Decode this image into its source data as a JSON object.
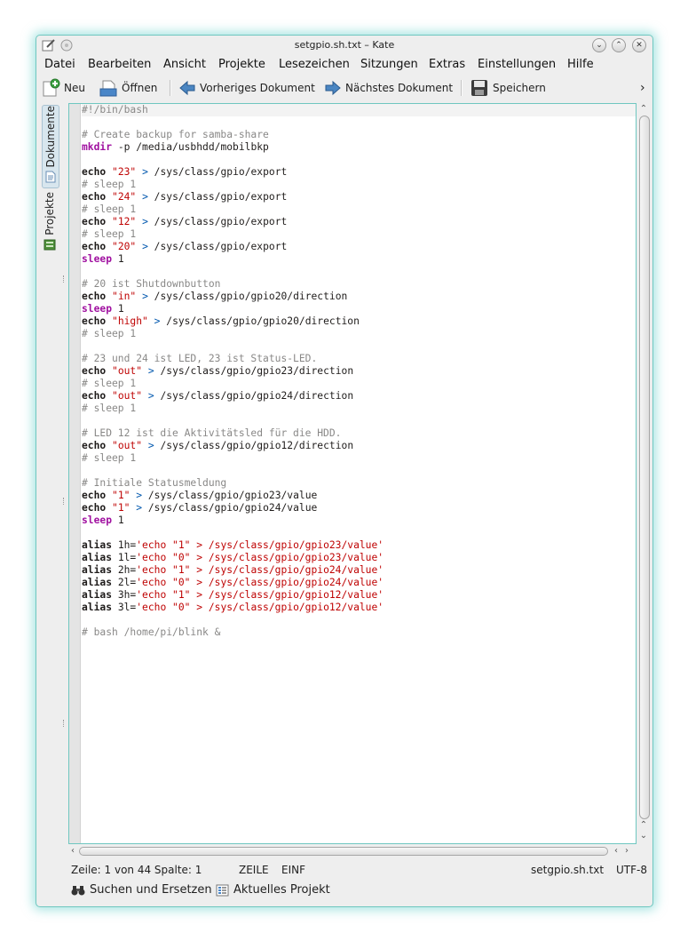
{
  "window": {
    "title": "setgpio.sh.txt – Kate"
  },
  "menu": [
    "Datei",
    "Bearbeiten",
    "Ansicht",
    "Projekte",
    "Lesezeichen",
    "Sitzungen",
    "Extras",
    "Einstellungen",
    "Hilfe"
  ],
  "toolbar": {
    "new_label": "Neu",
    "open_label": "Öffnen",
    "prev_label": "Vorheriges Dokument",
    "next_label": "Nächstes Dokument",
    "save_label": "Speichern",
    "overflow_label": "›"
  },
  "sidebar": {
    "tabs": [
      "Dokumente",
      "Projekte"
    ]
  },
  "editor": {
    "lines": [
      [
        [
          "comment",
          "#!/bin/bash"
        ]
      ],
      [],
      [
        [
          "comment",
          "# Create backup for samba-share"
        ]
      ],
      [
        [
          "cmd",
          "mkdir"
        ],
        [
          "text",
          " -p /media/usbhdd/mobilbkp"
        ]
      ],
      [],
      [
        [
          "kw",
          "echo"
        ],
        [
          "text",
          " "
        ],
        [
          "str",
          "\"23\""
        ],
        [
          "text",
          " "
        ],
        [
          "op",
          ">"
        ],
        [
          "text",
          " /sys/class/gpio/export"
        ]
      ],
      [
        [
          "comment",
          "# sleep 1"
        ]
      ],
      [
        [
          "kw",
          "echo"
        ],
        [
          "text",
          " "
        ],
        [
          "str",
          "\"24\""
        ],
        [
          "text",
          " "
        ],
        [
          "op",
          ">"
        ],
        [
          "text",
          " /sys/class/gpio/export"
        ]
      ],
      [
        [
          "comment",
          "# sleep 1"
        ]
      ],
      [
        [
          "kw",
          "echo"
        ],
        [
          "text",
          " "
        ],
        [
          "str",
          "\"12\""
        ],
        [
          "text",
          " "
        ],
        [
          "op",
          ">"
        ],
        [
          "text",
          " /sys/class/gpio/export"
        ]
      ],
      [
        [
          "comment",
          "# sleep 1"
        ]
      ],
      [
        [
          "kw",
          "echo"
        ],
        [
          "text",
          " "
        ],
        [
          "str",
          "\"20\""
        ],
        [
          "text",
          " "
        ],
        [
          "op",
          ">"
        ],
        [
          "text",
          " /sys/class/gpio/export"
        ]
      ],
      [
        [
          "cmd",
          "sleep"
        ],
        [
          "text",
          " 1"
        ]
      ],
      [],
      [
        [
          "comment",
          "# 20 ist Shutdownbutton"
        ]
      ],
      [
        [
          "kw",
          "echo"
        ],
        [
          "text",
          " "
        ],
        [
          "str",
          "\"in\""
        ],
        [
          "text",
          " "
        ],
        [
          "op",
          ">"
        ],
        [
          "text",
          " /sys/class/gpio/gpio20/direction"
        ]
      ],
      [
        [
          "cmd",
          "sleep"
        ],
        [
          "text",
          " 1"
        ]
      ],
      [
        [
          "kw",
          "echo"
        ],
        [
          "text",
          " "
        ],
        [
          "str",
          "\"high\""
        ],
        [
          "text",
          " "
        ],
        [
          "op",
          ">"
        ],
        [
          "text",
          " /sys/class/gpio/gpio20/direction"
        ]
      ],
      [
        [
          "comment",
          "# sleep 1"
        ]
      ],
      [],
      [
        [
          "comment",
          "# 23 und 24 ist LED, 23 ist Status-LED."
        ]
      ],
      [
        [
          "kw",
          "echo"
        ],
        [
          "text",
          " "
        ],
        [
          "str",
          "\"out\""
        ],
        [
          "text",
          " "
        ],
        [
          "op",
          ">"
        ],
        [
          "text",
          " /sys/class/gpio/gpio23/direction"
        ]
      ],
      [
        [
          "comment",
          "# sleep 1"
        ]
      ],
      [
        [
          "kw",
          "echo"
        ],
        [
          "text",
          " "
        ],
        [
          "str",
          "\"out\""
        ],
        [
          "text",
          " "
        ],
        [
          "op",
          ">"
        ],
        [
          "text",
          " /sys/class/gpio/gpio24/direction"
        ]
      ],
      [
        [
          "comment",
          "# sleep 1"
        ]
      ],
      [],
      [
        [
          "comment",
          "# LED 12 ist die Aktivitätsled für die HDD."
        ]
      ],
      [
        [
          "kw",
          "echo"
        ],
        [
          "text",
          " "
        ],
        [
          "str",
          "\"out\""
        ],
        [
          "text",
          " "
        ],
        [
          "op",
          ">"
        ],
        [
          "text",
          " /sys/class/gpio/gpio12/direction"
        ]
      ],
      [
        [
          "comment",
          "# sleep 1"
        ]
      ],
      [],
      [
        [
          "comment",
          "# Initiale Statusmeldung"
        ]
      ],
      [
        [
          "kw",
          "echo"
        ],
        [
          "text",
          " "
        ],
        [
          "str",
          "\"1\""
        ],
        [
          "text",
          " "
        ],
        [
          "op",
          ">"
        ],
        [
          "text",
          " /sys/class/gpio/gpio23/value"
        ]
      ],
      [
        [
          "kw",
          "echo"
        ],
        [
          "text",
          " "
        ],
        [
          "str",
          "\"1\""
        ],
        [
          "text",
          " "
        ],
        [
          "op",
          ">"
        ],
        [
          "text",
          " /sys/class/gpio/gpio24/value"
        ]
      ],
      [
        [
          "cmd",
          "sleep"
        ],
        [
          "text",
          " 1"
        ]
      ],
      [],
      [
        [
          "kw",
          "alias"
        ],
        [
          "text",
          " 1h="
        ],
        [
          "str",
          "'echo \"1\" > /sys/class/gpio/gpio23/value'"
        ]
      ],
      [
        [
          "kw",
          "alias"
        ],
        [
          "text",
          " 1l="
        ],
        [
          "str",
          "'echo \"0\" > /sys/class/gpio/gpio23/value'"
        ]
      ],
      [
        [
          "kw",
          "alias"
        ],
        [
          "text",
          " 2h="
        ],
        [
          "str",
          "'echo \"1\" > /sys/class/gpio/gpio24/value'"
        ]
      ],
      [
        [
          "kw",
          "alias"
        ],
        [
          "text",
          " 2l="
        ],
        [
          "str",
          "'echo \"0\" > /sys/class/gpio/gpio24/value'"
        ]
      ],
      [
        [
          "kw",
          "alias"
        ],
        [
          "text",
          " 3h="
        ],
        [
          "str",
          "'echo \"1\" > /sys/class/gpio/gpio12/value'"
        ]
      ],
      [
        [
          "kw",
          "alias"
        ],
        [
          "text",
          " 3l="
        ],
        [
          "str",
          "'echo \"0\" > /sys/class/gpio/gpio12/value'"
        ]
      ],
      [],
      [
        [
          "comment",
          "# bash /home/pi/blink &"
        ]
      ]
    ]
  },
  "status": {
    "position": "Zeile: 1 von 44 Spalte: 1",
    "mode": "ZEILE",
    "insert": "EINF",
    "filename": "setgpio.sh.txt",
    "encoding": "UTF-8"
  },
  "bottom": {
    "search_label": "Suchen und Ersetzen",
    "project_label": "Aktuelles Projekt"
  },
  "colors": {
    "accent": "#6fc7c0",
    "keyword_color": "#a010a0",
    "string_color": "#bf0303",
    "comment_color": "#898887"
  }
}
